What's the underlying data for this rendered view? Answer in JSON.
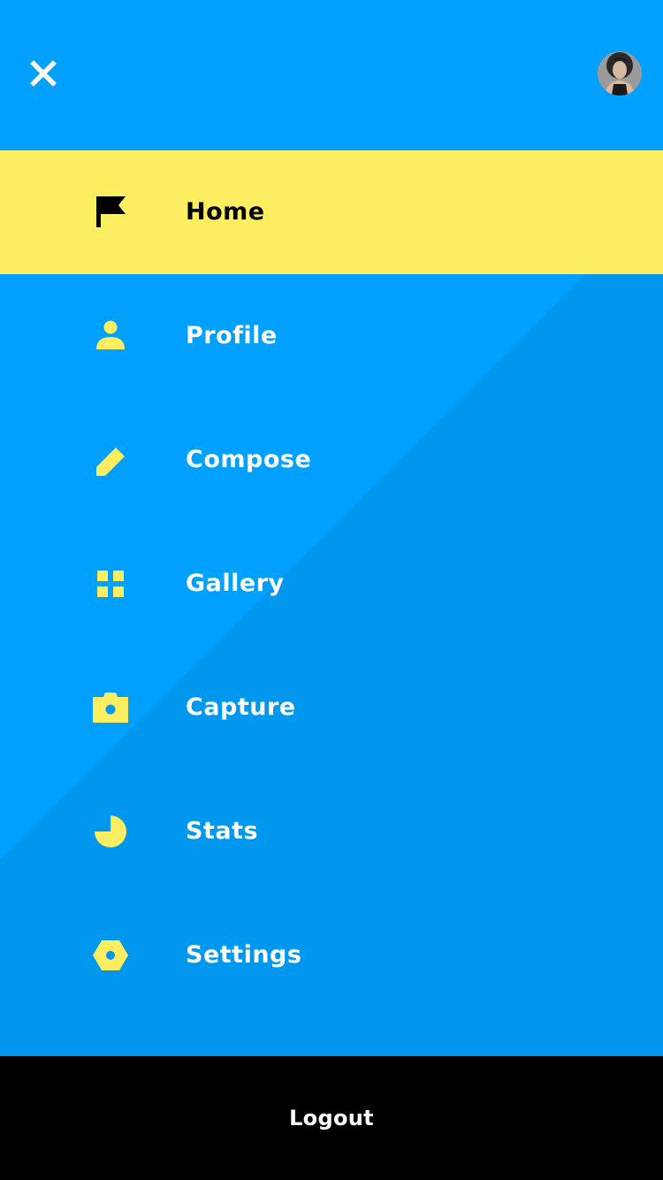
{
  "colors": {
    "background": "#00A0FE",
    "background_shade": "#0098EF",
    "accent": "#FCEE60",
    "active_text": "#000000",
    "text": "#FFFFFF",
    "logout_bar": "#000000"
  },
  "header": {
    "close_icon": "close-icon",
    "avatar_icon": "user-avatar"
  },
  "menu": {
    "items": [
      {
        "label": "Home",
        "icon": "flag-icon",
        "active": true
      },
      {
        "label": "Profile",
        "icon": "person-icon",
        "active": false
      },
      {
        "label": "Compose",
        "icon": "pencil-icon",
        "active": false
      },
      {
        "label": "Gallery",
        "icon": "grid-icon",
        "active": false
      },
      {
        "label": "Capture",
        "icon": "camera-icon",
        "active": false
      },
      {
        "label": "Stats",
        "icon": "pie-chart-icon",
        "active": false
      },
      {
        "label": "Settings",
        "icon": "hexagon-gear-icon",
        "active": false
      }
    ]
  },
  "footer": {
    "logout_label": "Logout"
  }
}
